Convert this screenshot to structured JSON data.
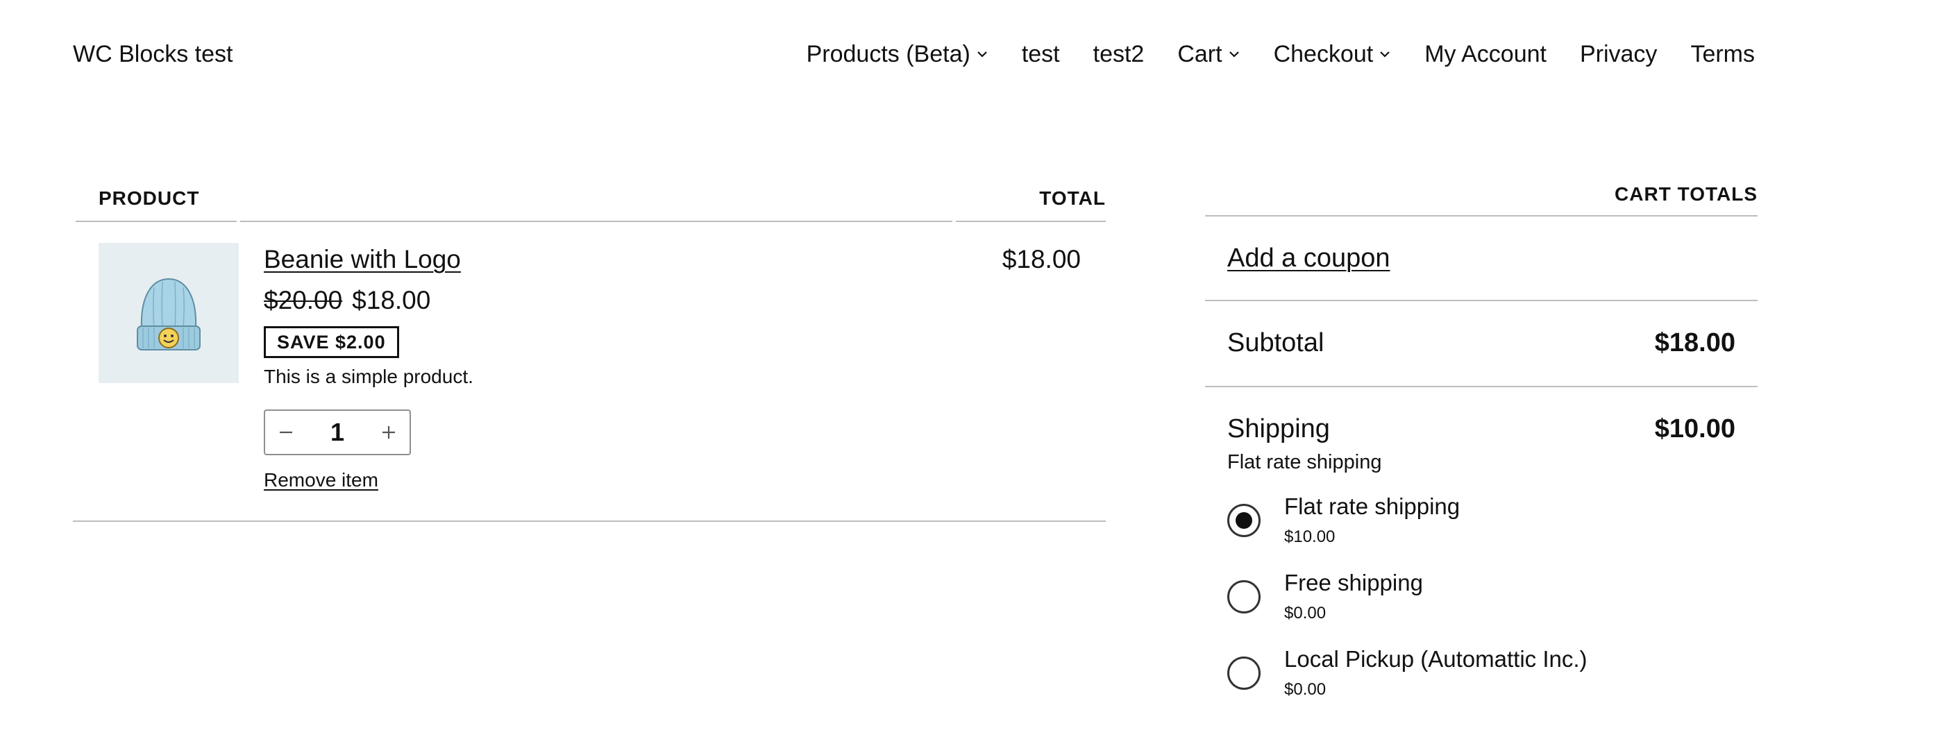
{
  "header": {
    "site_title": "WC Blocks test",
    "nav": [
      {
        "label": "Products (Beta)",
        "has_submenu": true
      },
      {
        "label": "test",
        "has_submenu": false
      },
      {
        "label": "test2",
        "has_submenu": false
      },
      {
        "label": "Cart",
        "has_submenu": true
      },
      {
        "label": "Checkout",
        "has_submenu": true
      },
      {
        "label": "My Account",
        "has_submenu": false
      },
      {
        "label": "Privacy",
        "has_submenu": false
      },
      {
        "label": "Terms",
        "has_submenu": false
      }
    ],
    "submenu_icon": "chevron-down-icon"
  },
  "cart": {
    "columns": {
      "product": "PRODUCT",
      "total": "TOTAL"
    },
    "items": [
      {
        "name": "Beanie with Logo",
        "image_icon": "beanie-image",
        "regular_price": "$20.00",
        "sale_price": "$18.00",
        "save_badge": "SAVE $2.00",
        "short_description": "This is a simple product.",
        "quantity": "1",
        "decrease_icon": "minus-icon",
        "increase_icon": "plus-icon",
        "remove_label": "Remove item",
        "line_total": "$18.00"
      }
    ]
  },
  "totals": {
    "title": "CART TOTALS",
    "coupon_label": "Add a coupon",
    "subtotal_label": "Subtotal",
    "subtotal_value": "$18.00",
    "shipping_label": "Shipping",
    "shipping_value": "$10.00",
    "shipping_selected": "Flat rate shipping",
    "rates": [
      {
        "label": "Flat rate shipping",
        "price": "$10.00",
        "selected": true
      },
      {
        "label": "Free shipping",
        "price": "$0.00",
        "selected": false
      },
      {
        "label": "Local Pickup (Automattic Inc.)",
        "price": "$0.00",
        "selected": false
      }
    ]
  }
}
